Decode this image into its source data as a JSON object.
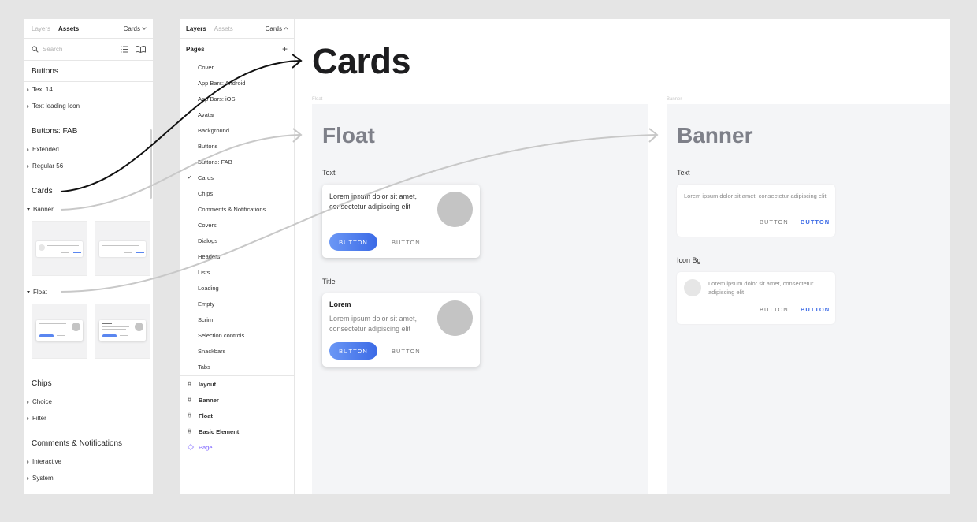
{
  "colors": {
    "background": "#e5e5e5",
    "accent": "#3b6ae6",
    "component": "#7b61ff",
    "frame_bg": "#f4f5f7"
  },
  "assets_panel": {
    "tabs": [
      "Layers",
      "Assets"
    ],
    "active_tab": "Assets",
    "page_selector": "Cards",
    "search_placeholder": "Search",
    "sections": {
      "buttons": {
        "title": "Buttons",
        "items": [
          "Text 14",
          "Text leading Icon"
        ]
      },
      "buttons_fab": {
        "title": "Buttons: FAB",
        "items": [
          "Extended",
          "Regular 56"
        ]
      },
      "cards": {
        "title": "Cards",
        "groups": [
          "Banner",
          "Float"
        ]
      },
      "chips": {
        "title": "Chips",
        "items": [
          "Choice",
          "Filter"
        ]
      },
      "comments": {
        "title": "Comments & Notifications",
        "items": [
          "Interactive",
          "System"
        ]
      }
    },
    "icons": [
      "search-icon",
      "list-view-icon",
      "library-book-icon"
    ]
  },
  "pages_panel": {
    "tabs": [
      "Layers",
      "Assets"
    ],
    "active_tab": "Layers",
    "page_selector": "Cards",
    "pages_header": "Pages",
    "pages": [
      "Cover",
      "App Bars: Android",
      "App Bars: iOS",
      "Avatar",
      "Background",
      "Buttons",
      "Buttons: FAB",
      "Cards",
      "Chips",
      "Comments & Notifications",
      "Covers",
      "Dialogs",
      "Headers",
      "Lists",
      "Loading",
      "Empty",
      "Scrim",
      "Selection controls",
      "Snackbars",
      "Tabs"
    ],
    "current_page": "Cards",
    "frames": [
      "layout",
      "Banner",
      "Float",
      "Basic Element"
    ],
    "component": "Page"
  },
  "canvas": {
    "title": "Cards",
    "float_frame": {
      "label": "Float",
      "heading": "Float",
      "text_label": "Text",
      "text_card": {
        "body": "Lorem ipsum dolor sit amet, consectetur adipiscing elit",
        "primary": "BUTTON",
        "secondary": "BUTTON"
      },
      "title_label": "Title",
      "title_card": {
        "title": "Lorem",
        "body": "Lorem ipsum dolor sit amet, consectetur adipiscing elit",
        "primary": "BUTTON",
        "secondary": "BUTTON"
      }
    },
    "banner_frame": {
      "label": "Banner",
      "heading": "Banner",
      "text_label": "Text",
      "text_card": {
        "body": "Lorem ipsum dolor sit amet, consectetur adipiscing elit",
        "btn1": "BUTTON",
        "btn2": "BUTTON"
      },
      "icon_label": "Icon Bg",
      "icon_card": {
        "body": "Lorem ipsum dolor sit amet, consectetur adipiscing elit",
        "btn1": "BUTTON",
        "btn2": "BUTTON"
      }
    }
  }
}
